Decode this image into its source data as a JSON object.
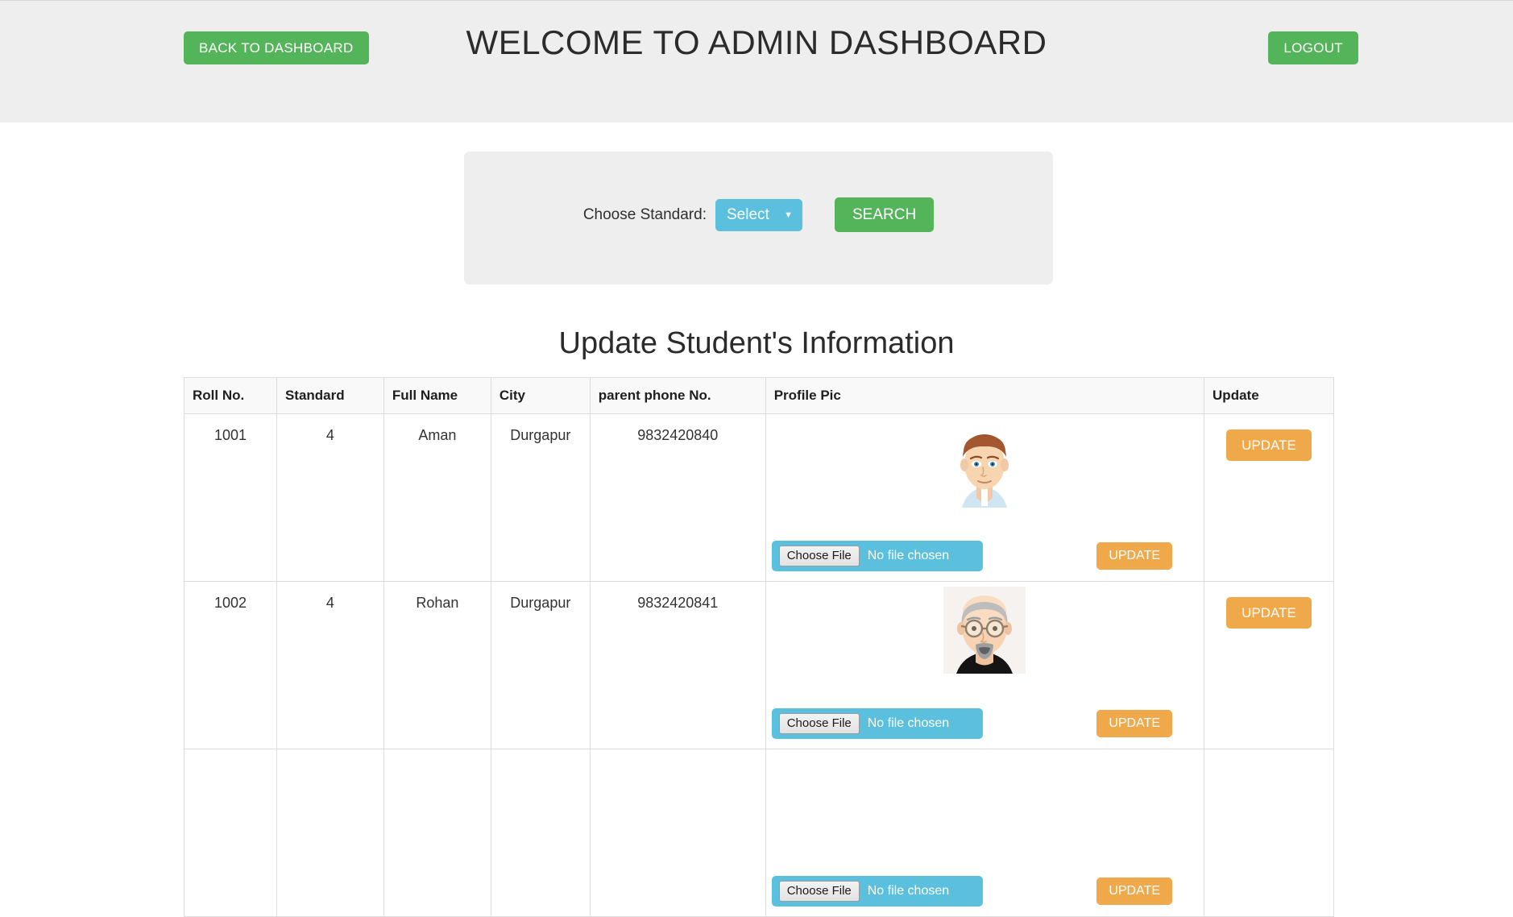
{
  "header": {
    "title": "WELCOME TO ADMIN DASHBOARD",
    "back_label": "BACK TO DASHBOARD",
    "logout_label": "LOGOUT",
    "background": "#eeeeee",
    "button_color": "#54b45a"
  },
  "search_panel": {
    "choose_label": "Choose Standard:",
    "select_value": "Select",
    "select_caret": "▼",
    "search_label": "SEARCH",
    "select_color": "#5bc0de",
    "search_color": "#54b45a",
    "panel_color": "#eeeeee"
  },
  "section": {
    "title": "Update Student's Information"
  },
  "table": {
    "columns": [
      "Roll No.",
      "Standard",
      "Full Name",
      "City",
      "parent phone No.",
      "Profile Pic",
      "Update"
    ],
    "file_button_label": "Choose File",
    "file_status_label": "No file chosen",
    "inline_update_label": "UPDATE",
    "row_update_label": "UPDATE",
    "update_color": "#efa94b",
    "file_input_color": "#5bc0de",
    "rows": [
      {
        "roll_no": "1001",
        "standard": "4",
        "full_name": "Aman",
        "city": "Durgapur",
        "parent_phone": "9832420840",
        "avatar": "male-young-brown-hair-avatar",
        "file_button_label": "Choose File",
        "file_status_label": "No file chosen",
        "inline_update_label": "UPDATE",
        "row_update_label": "UPDATE"
      },
      {
        "roll_no": "1002",
        "standard": "4",
        "full_name": "Rohan",
        "city": "Durgapur",
        "parent_phone": "9832420841",
        "avatar": "male-older-bald-glasses-goatee-avatar",
        "file_button_label": "Choose File",
        "file_status_label": "No file chosen",
        "inline_update_label": "UPDATE",
        "row_update_label": "UPDATE"
      },
      {
        "roll_no": "",
        "standard": "",
        "full_name": "",
        "city": "",
        "parent_phone": "",
        "avatar": "",
        "file_button_label": "Choose File",
        "file_status_label": "No file chosen",
        "inline_update_label": "UPDATE",
        "row_update_label": ""
      }
    ]
  }
}
